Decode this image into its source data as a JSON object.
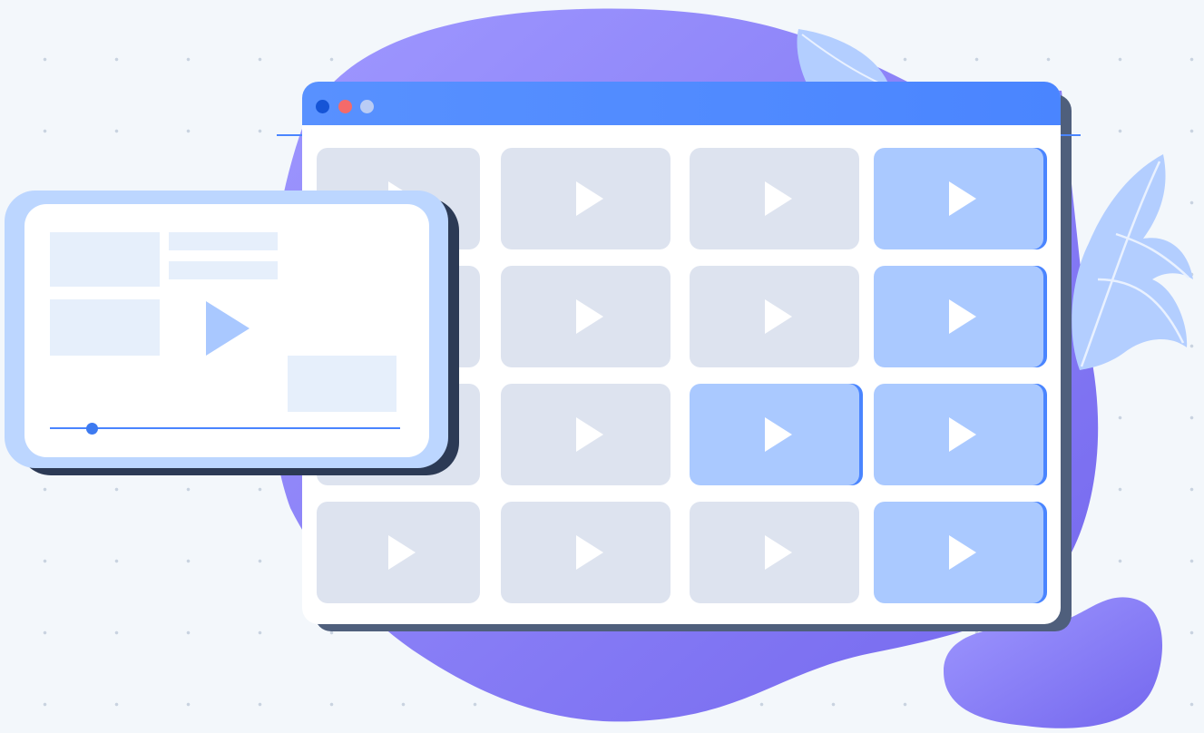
{
  "illustration": {
    "background_color": "#f3f7fb",
    "blob_colors": [
      "#9d94ff",
      "#7a6df0"
    ],
    "accent_color": "#4a85ff",
    "browser": {
      "window_controls": [
        "close-dot",
        "minimize-dot",
        "maximize-dot"
      ],
      "tile_rows": 4,
      "tile_columns": 4,
      "highlighted_tiles": [
        [
          0,
          3
        ],
        [
          1,
          3
        ],
        [
          2,
          2
        ],
        [
          2,
          3
        ],
        [
          3,
          3
        ]
      ],
      "tile_icon": "play-icon",
      "tile_color": "#dde3ef",
      "highlight_color": "#aac9ff"
    },
    "video_player": {
      "icon": "play-icon",
      "progress": 0.12
    },
    "leaf_color": "#b3ceff"
  }
}
